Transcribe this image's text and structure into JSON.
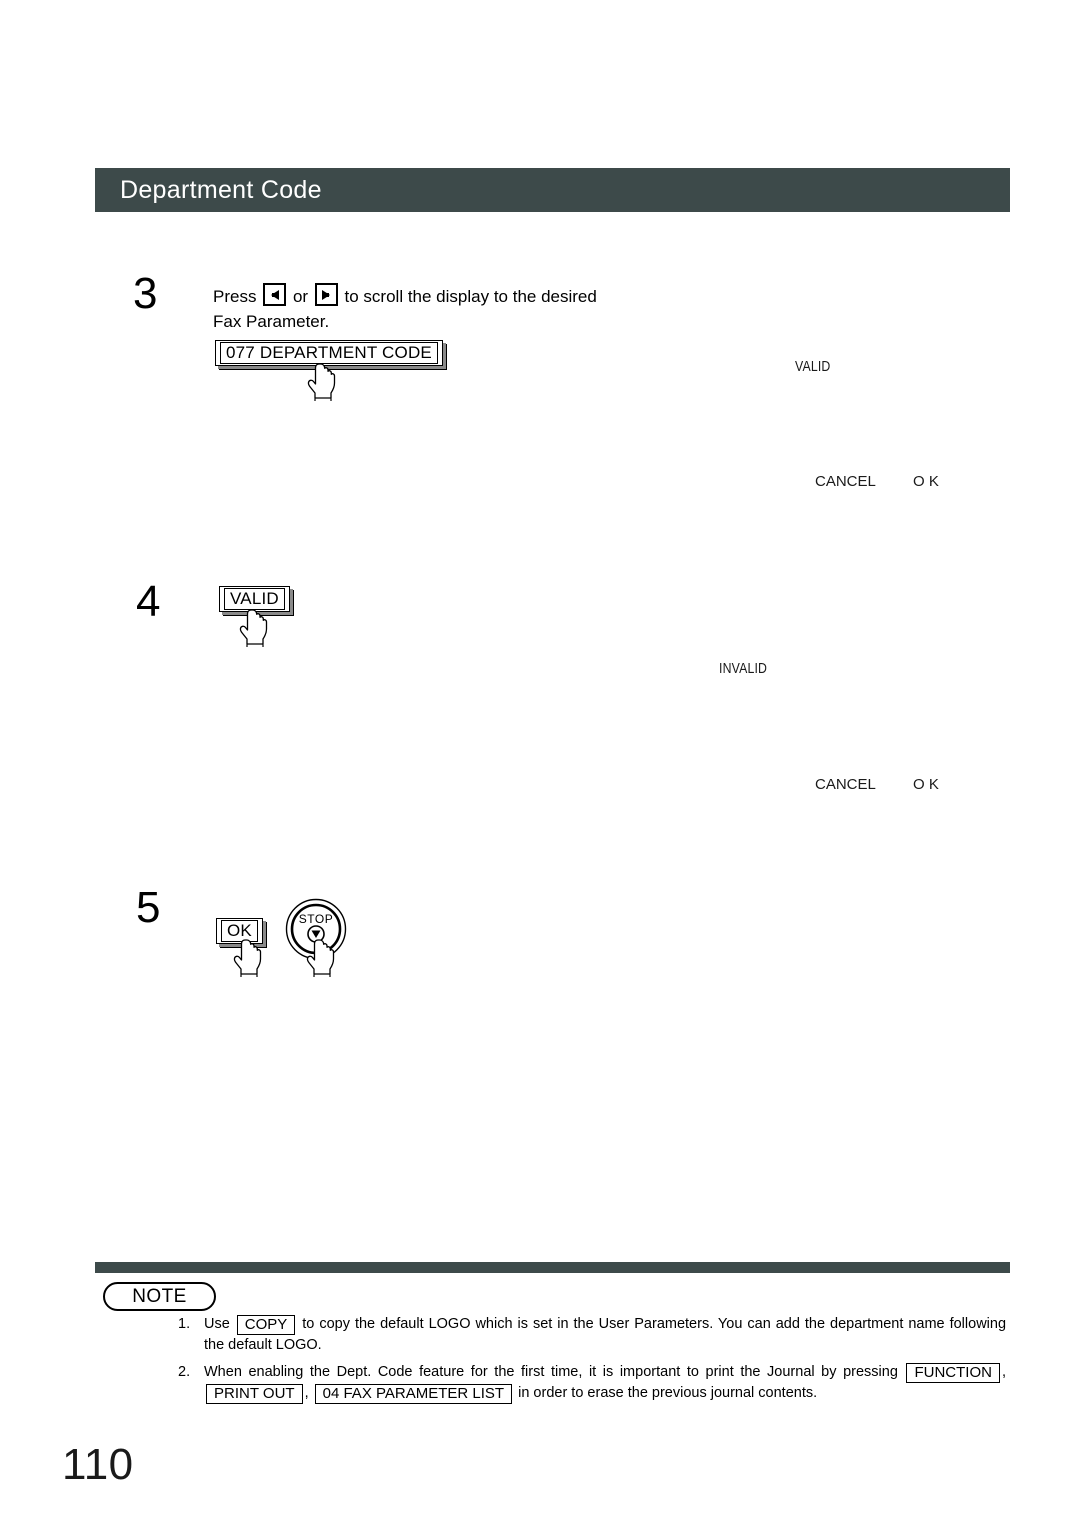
{
  "document": {
    "section_title": "Department Code",
    "page_number": "110"
  },
  "steps": [
    {
      "number": "3",
      "text_line1_before": "Press",
      "key_left_icon": "arrow-left-icon",
      "text_between": "or",
      "key_right_icon": "arrow-right-icon",
      "text_line1_after": "to scroll the display to the desired",
      "text_line2": "Fax Parameter.",
      "button_label": "077 DEPARTMENT CODE",
      "lcd": {
        "value": "VALID",
        "softkey_cancel": "CANCEL",
        "softkey_ok": "O K"
      }
    },
    {
      "number": "4",
      "button_label": "VALID",
      "lcd": {
        "value": "INVALID",
        "softkey_cancel": "CANCEL",
        "softkey_ok": "O K"
      }
    },
    {
      "number": "5",
      "button_label": "OK",
      "stop_button_label": "STOP"
    }
  ],
  "note": {
    "title": "NOTE",
    "items": [
      {
        "marker": "1.",
        "part1": "Use",
        "key1": "COPY",
        "part2": "to copy the default LOGO which is set in the User Parameters.  You can add the department name following the default LOGO."
      },
      {
        "marker": "2.",
        "part1": "When enabling the Dept. Code feature for the first time, it is important to print the Journal by pressing",
        "key1": "FUNCTION",
        "sep1": ",",
        "key2": "PRINT OUT",
        "sep2": ",",
        "key3": "04 FAX PARAMETER LIST",
        "part2": "in order to erase the previous journal contents."
      }
    ]
  },
  "colors": {
    "header_bar": "#3d4a4a",
    "header_text": "#ffffff",
    "body_text": "#000000",
    "page_background": "#ffffff"
  }
}
